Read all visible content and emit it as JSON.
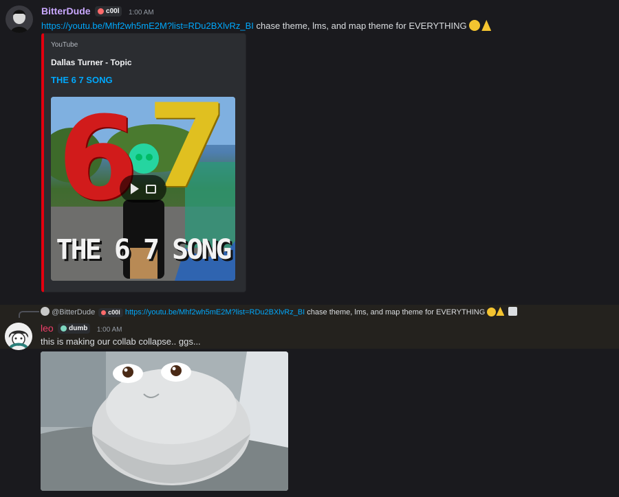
{
  "messages": [
    {
      "username": "BitterDude",
      "username_color": "#c9a8ff",
      "tag": "c00l",
      "time": "1:00 AM",
      "link": "https://youtu.be/Mhf2wh5mE2M?list=RDu2BXlvRz_BI",
      "text": " chase theme, lms, and map theme for EVERYTHING",
      "embed": {
        "provider": "YouTube",
        "author": "Dallas Turner - Topic",
        "title": "THE 6 7 SONG",
        "thumbnail_text": "THE 6 7 SONG",
        "thumbnail_digits": [
          "6",
          "7"
        ],
        "accent_color": "#e3000f"
      }
    },
    {
      "reply": {
        "mention": "@BitterDude",
        "tag": "c00l",
        "link": "https://youtu.be/Mhf2wh5mE2M?list=RDu2BXlvRz_BI",
        "text": " chase theme, lms, and map theme for EVERYTHING"
      },
      "username": "leo",
      "username_color": "#f23f6b",
      "tag": "dumb",
      "time": "1:00 AM",
      "text": "this is making our collab collapse.. ggs..."
    }
  ]
}
